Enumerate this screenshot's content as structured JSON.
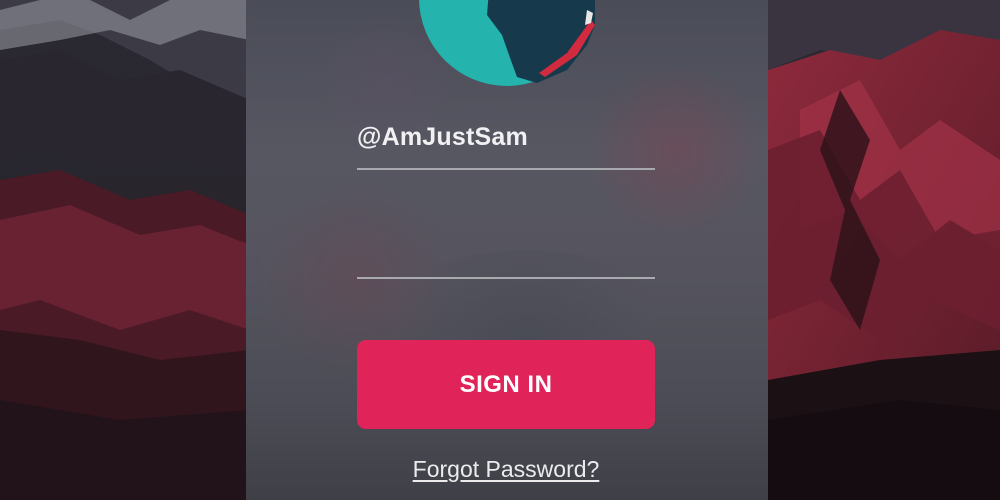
{
  "login": {
    "username_value": "@AmJustSam",
    "password_value": "",
    "signin_label": "SIGN IN",
    "forgot_label": "Forgot Password?"
  },
  "icons": {
    "avatar": "globe-avatar-icon"
  },
  "colors": {
    "accent": "#e0245a",
    "panel": "#55545e",
    "field_underline": "#a9a9b0",
    "text": "#f1f1f3"
  }
}
